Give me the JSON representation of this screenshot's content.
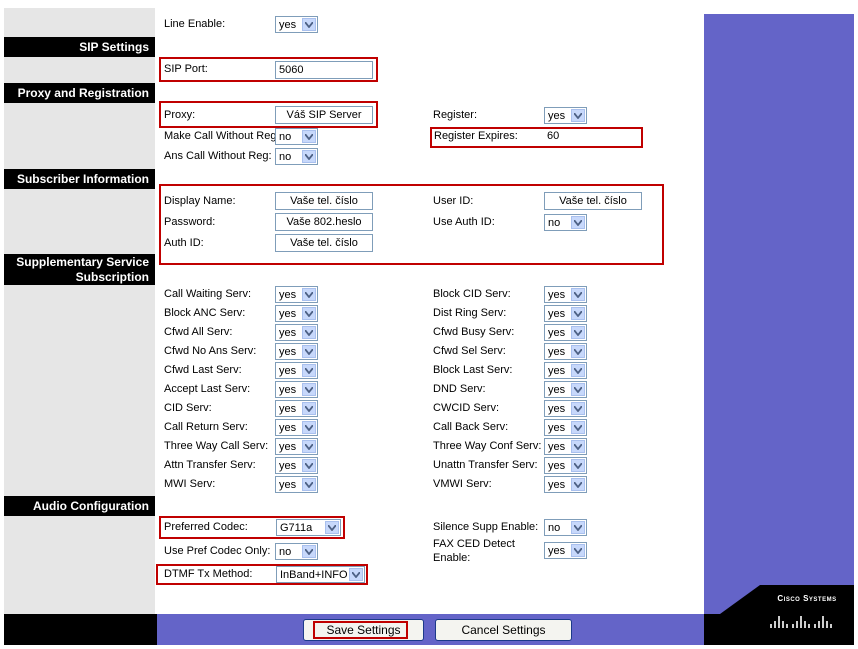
{
  "sections": {
    "sip": "SIP Settings",
    "proxy": "Proxy and Registration",
    "subscriber": "Subscriber Information",
    "supplementary_line1": "Supplementary Service",
    "supplementary_line2": "Subscription",
    "audio": "Audio Configuration"
  },
  "line_enable": {
    "label": "Line Enable:",
    "value": "yes"
  },
  "sip_port": {
    "label": "SIP Port:",
    "value": "5060"
  },
  "proxy": {
    "label": "Proxy:",
    "value": "Váš SIP Server"
  },
  "register": {
    "label": "Register:",
    "value": "yes"
  },
  "make_call_without_reg": {
    "label": "Make Call Without Reg:",
    "value": "no"
  },
  "register_expires": {
    "label": "Register Expires:",
    "value": "60"
  },
  "ans_call_without_reg": {
    "label": "Ans Call Without Reg:",
    "value": "no"
  },
  "display_name": {
    "label": "Display Name:",
    "value": "Vaše tel. číslo"
  },
  "user_id": {
    "label": "User ID:",
    "value": "Vaše tel. číslo"
  },
  "password": {
    "label": "Password:",
    "value": "Vaše 802.heslo"
  },
  "use_auth_id": {
    "label": "Use Auth ID:",
    "value": "no"
  },
  "auth_id": {
    "label": "Auth ID:",
    "value": "Vaše tel. číslo"
  },
  "services_left": [
    {
      "label": "Call Waiting Serv:",
      "value": "yes"
    },
    {
      "label": "Block ANC Serv:",
      "value": "yes"
    },
    {
      "label": "Cfwd All Serv:",
      "value": "yes"
    },
    {
      "label": "Cfwd No Ans Serv:",
      "value": "yes"
    },
    {
      "label": "Cfwd Last Serv:",
      "value": "yes"
    },
    {
      "label": "Accept Last Serv:",
      "value": "yes"
    },
    {
      "label": "CID Serv:",
      "value": "yes"
    },
    {
      "label": "Call Return Serv:",
      "value": "yes"
    },
    {
      "label": "Three Way Call Serv:",
      "value": "yes"
    },
    {
      "label": "Attn Transfer Serv:",
      "value": "yes"
    },
    {
      "label": "MWI Serv:",
      "value": "yes"
    }
  ],
  "services_right": [
    {
      "label": "Block CID Serv:",
      "value": "yes"
    },
    {
      "label": "Dist Ring Serv:",
      "value": "yes"
    },
    {
      "label": "Cfwd Busy Serv:",
      "value": "yes"
    },
    {
      "label": "Cfwd Sel Serv:",
      "value": "yes"
    },
    {
      "label": "Block Last Serv:",
      "value": "yes"
    },
    {
      "label": "DND Serv:",
      "value": "yes"
    },
    {
      "label": "CWCID Serv:",
      "value": "yes"
    },
    {
      "label": "Call Back Serv:",
      "value": "yes"
    },
    {
      "label": "Three Way Conf Serv:",
      "value": "yes"
    },
    {
      "label": "Unattn Transfer Serv:",
      "value": "yes"
    },
    {
      "label": "VMWI Serv:",
      "value": "yes"
    }
  ],
  "preferred_codec": {
    "label": "Preferred Codec:",
    "value": "G711a"
  },
  "silence_supp": {
    "label": "Silence Supp Enable:",
    "value": "no"
  },
  "use_pref_codec_only": {
    "label": "Use Pref Codec Only:",
    "value": "no"
  },
  "fax_ced_line1": "FAX CED Detect",
  "fax_ced_line2": "Enable:",
  "fax_ced_value": "yes",
  "dtmf_tx": {
    "label": "DTMF Tx Method:",
    "value": "InBand+INFO"
  },
  "buttons": {
    "save": "Save Settings",
    "cancel": "Cancel Settings"
  },
  "logo": {
    "text": "Cisco Systems"
  },
  "colors": {
    "accent": "#6464c8",
    "highlight": "#c00000",
    "header": "#000000"
  }
}
